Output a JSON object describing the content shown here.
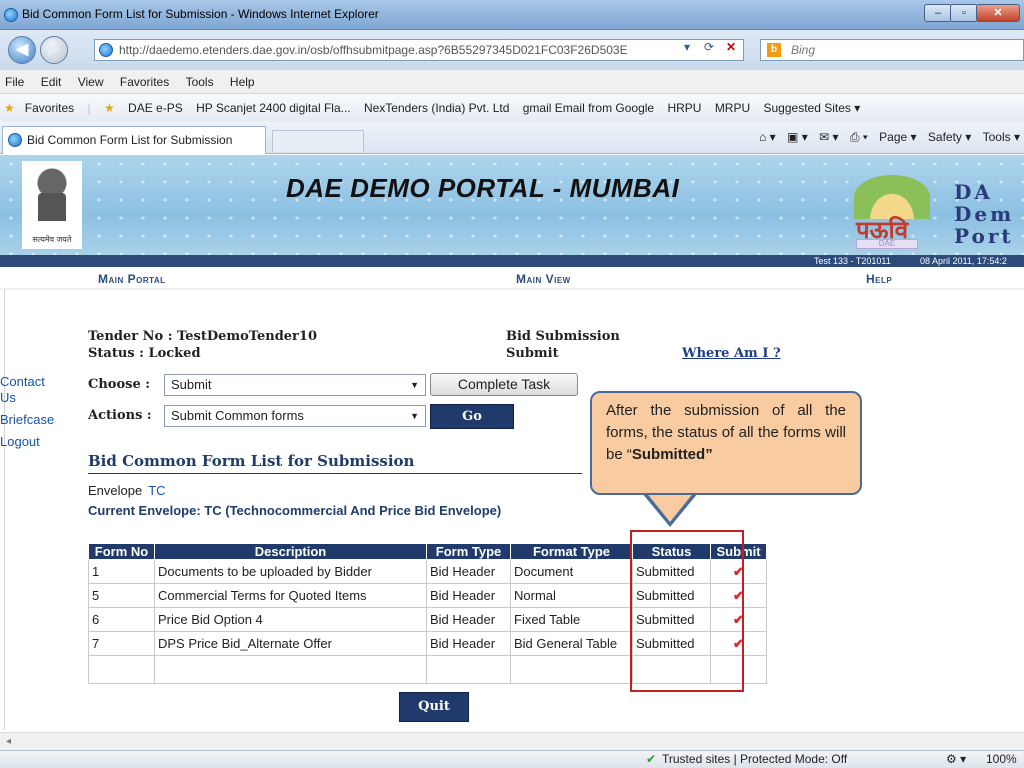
{
  "window": {
    "title": "Bid Common Form List for Submission - Windows Internet Explorer",
    "minimize": "–",
    "maximize": "▫",
    "close": "✕"
  },
  "address": {
    "url": "http://daedemo.etenders.dae.gov.in/osb/offhsubmitpage.asp?6B55297345D021FC03F26D503E",
    "search_placeholder": "Bing"
  },
  "menu": [
    "File",
    "Edit",
    "View",
    "Favorites",
    "Tools",
    "Help"
  ],
  "favorites": {
    "label": "Favorites",
    "items": [
      "DAE e-PS",
      "HP Scanjet 2400 digital Fla...",
      "NexTenders (India) Pvt. Ltd",
      "gmail Email from Google",
      "HRPU",
      "MRPU",
      "Suggested Sites ▾"
    ]
  },
  "tab": {
    "title": "Bid Common Form List for Submission"
  },
  "command_bar": [
    "Page ▾",
    "Safety ▾",
    "Tools ▾"
  ],
  "banner": {
    "title": "DAE DEMO PORTAL - MUMBAI",
    "emblem_caption": "सत्यमेव जयते",
    "logo_hindi": "पऊवि",
    "logo_box": "DAE",
    "side_text": [
      "DA",
      "Dem",
      "Port"
    ]
  },
  "infobar": {
    "user": "Test 133 - T201011",
    "datetime": "08 April 2011,  17:54:2"
  },
  "topnav": {
    "main_portal": "Main Portal",
    "main_view": "Main View",
    "help": "Help"
  },
  "sidebar": [
    "Contact Us",
    "Briefcase",
    "Logout"
  ],
  "tender": {
    "no": "Tender No : TestDemoTender10",
    "status": "Status : Locked",
    "stage": "Bid Submission",
    "substage": "Submit",
    "where_am_i": "Where Am I ?"
  },
  "choose": {
    "label": "Choose :",
    "value": "Submit",
    "button": "Complete Task"
  },
  "actions": {
    "label": "Actions :",
    "value": "Submit Common forms",
    "button": "Go"
  },
  "section": {
    "title": "Bid Common Form List for Submission",
    "envelope_label": "Envelope",
    "envelope_value": "TC",
    "current_envelope": "Current Envelope: TC (Technocommercial And Price Bid Envelope)"
  },
  "table": {
    "headers": [
      "Form No",
      "Description",
      "Form Type",
      "Format Type",
      "Status",
      "Submit"
    ],
    "rows": [
      [
        "1",
        "Documents to be uploaded by Bidder",
        "Bid Header",
        "Document",
        "Submitted",
        "✔"
      ],
      [
        "5",
        "Commercial Terms for Quoted Items",
        "Bid Header",
        "Normal",
        "Submitted",
        "✔"
      ],
      [
        "6",
        "Price Bid Option 4",
        "Bid Header",
        "Fixed Table",
        "Submitted",
        "✔"
      ],
      [
        "7",
        "DPS Price Bid_Alternate Offer",
        "Bid Header",
        "Bid General Table",
        "Submitted",
        "✔"
      ]
    ]
  },
  "callout": {
    "text": "After the submission of all the forms, the status of all the forms will be “",
    "bold": "Submitted”"
  },
  "quit": "Quit",
  "status": {
    "zone": "Trusted sites | Protected Mode: Off",
    "zoom": "100%"
  },
  "colors": {
    "navy": "#1f3a6b",
    "link": "#1155aa",
    "callout": "#f8cba0",
    "highlight": "#c02020"
  }
}
